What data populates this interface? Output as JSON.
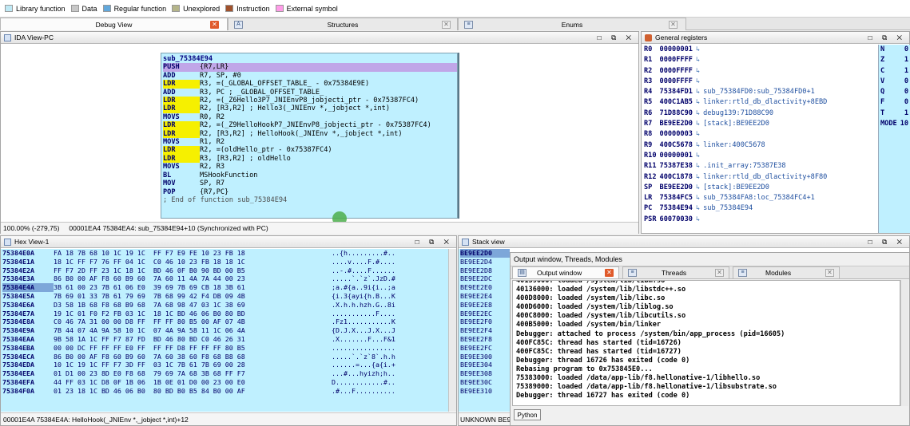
{
  "legend": [
    {
      "label": "Library function",
      "color": "#bfe9f5"
    },
    {
      "label": "Data",
      "color": "#c8c8c8"
    },
    {
      "label": "Regular function",
      "color": "#62a8dc"
    },
    {
      "label": "Unexplored",
      "color": "#b5b58a"
    },
    {
      "label": "Instruction",
      "color": "#a0522d"
    },
    {
      "label": "External symbol",
      "color": "#ff9ce8"
    }
  ],
  "tabs": {
    "debug_view": "Debug View",
    "structures": "Structures",
    "enums": "Enums"
  },
  "ida_view": {
    "title": "IDA View-PC",
    "func_label": "sub_75384E94",
    "lines": [
      {
        "op": "PUSH",
        "args": "{R7,LR}"
      },
      {
        "op": "ADD",
        "args": "R7, SP, #0"
      },
      {
        "op": "LDR",
        "args": "R3, =(_GLOBAL_OFFSET_TABLE_ - 0x75384E9E)"
      },
      {
        "op": "ADD",
        "args": "R3, PC ; _GLOBAL_OFFSET_TABLE_"
      },
      {
        "op": "LDR",
        "args": "R2, =(_Z6Hello3P7_JNIEnvP8_jobjecti_ptr - 0x75387FC4)"
      },
      {
        "op": "LDR",
        "args": "R2, [R3,R2] ; Hello3(_JNIEnv *,_jobject *,int)"
      },
      {
        "op": "MOVS",
        "args": "R0, R2"
      },
      {
        "op": "LDR",
        "args": "R2, =(_Z9HelloHookP7_JNIEnvP8_jobjecti_ptr - 0x75387FC4)"
      },
      {
        "op": "LDR",
        "args": "R2, [R3,R2] ; HelloHook(_JNIEnv *,_jobject *,int)"
      },
      {
        "op": "MOVS",
        "args": "R1, R2"
      },
      {
        "op": "LDR",
        "args": "R2, =(oldHello_ptr - 0x75387FC4)"
      },
      {
        "op": "LDR",
        "args": "R3, [R3,R2] ; oldHello"
      },
      {
        "op": "MOVS",
        "args": "R2, R3"
      },
      {
        "op": "BL",
        "args": "MSHookFunction"
      },
      {
        "op": "MOV",
        "args": "SP, R7"
      },
      {
        "op": "POP",
        "args": "{R7,PC}"
      }
    ],
    "end_comment": "; End of function sub_75384E94",
    "status_zoom": "100.00% (-279,75)",
    "status_loc": "00001EA4 75384EA4: sub_75384E94+10 (Synchronized with PC)"
  },
  "registers": {
    "title": "General registers",
    "rows": [
      {
        "name": "R0",
        "val": "00000001",
        "note": ""
      },
      {
        "name": "R1",
        "val": "0000FFFF",
        "note": ""
      },
      {
        "name": "R2",
        "val": "0000FFFF",
        "note": ""
      },
      {
        "name": "R3",
        "val": "0000FFFF",
        "note": ""
      },
      {
        "name": "R4",
        "val": "75384FD1",
        "note": "sub_75384FD0:sub_75384FD0+1"
      },
      {
        "name": "R5",
        "val": "400C1AB5",
        "note": "linker:rtld_db_dlactivity+8EBD"
      },
      {
        "name": "R6",
        "val": "71D88C90",
        "note": "debug139:71D88C90"
      },
      {
        "name": "R7",
        "val": "BE9EE2D0",
        "note": "[stack]:BE9EE2D0"
      },
      {
        "name": "R8",
        "val": "00000003",
        "note": ""
      },
      {
        "name": "R9",
        "val": "400C5678",
        "note": "linker:400C5678"
      },
      {
        "name": "R10",
        "val": "00000001",
        "note": ""
      },
      {
        "name": "R11",
        "val": "75387E38",
        "note": ".init_array:75387E38"
      },
      {
        "name": "R12",
        "val": "400C1878",
        "note": "linker:rtld_db_dlactivity+8F80"
      },
      {
        "name": "SP",
        "val": "BE9EE2D0",
        "note": "[stack]:BE9EE2D0"
      },
      {
        "name": "LR",
        "val": "75384FC5",
        "note": "sub_75384FA8:loc_75384FC4+1"
      },
      {
        "name": "PC",
        "val": "75384E94",
        "note": "sub_75384E94"
      },
      {
        "name": "PSR",
        "val": "60070030",
        "note": ""
      }
    ],
    "flags": [
      {
        "name": "N",
        "val": "0"
      },
      {
        "name": "Z",
        "val": "1"
      },
      {
        "name": "C",
        "val": "1"
      },
      {
        "name": "V",
        "val": "0"
      },
      {
        "name": "Q",
        "val": "0"
      },
      {
        "name": "F",
        "val": "0"
      },
      {
        "name": "T",
        "val": "1"
      },
      {
        "name": "MODE",
        "val": "10"
      }
    ]
  },
  "hex_view": {
    "title": "Hex View-1",
    "rows": [
      {
        "addr": "75384E0A",
        "bytes": "FA 18 7B 68 10 1C 19 1C  FF F7 E9 FE 10 23 FB 18",
        "ascii": "..{h.........#.."
      },
      {
        "addr": "75384E1A",
        "bytes": "18 1C FF F7 76 FF 04 1C  C0 46 10 23 FB 18 18 1C",
        "ascii": "....v....F.#...."
      },
      {
        "addr": "75384E2A",
        "bytes": "FF F7 2D FF 23 1C 18 1C  BD 46 0F B0 90 BD 00 B5",
        "ascii": "..-.#....F......"
      },
      {
        "addr": "75384E3A",
        "bytes": "86 B0 00 AF F8 60 B9 60  7A 60 11 4A 7A 44 00 23",
        "ascii": ".....`.`z`.JzD.#"
      },
      {
        "addr": "75384E4A",
        "bytes": "3B 61 00 23 7B 61 06 E0  39 69 7B 69 CB 18 3B 61",
        "ascii": ";a.#{a..9i{i..;a"
      },
      {
        "addr": "75384E5A",
        "bytes": "7B 69 01 33 7B 61 79 69  7B 68 99 42 F4 DB 09 4B",
        "ascii": "{i.3{ayi{h.B...K"
      },
      {
        "addr": "75384E6A",
        "bytes": "D3 58 1B 68 F8 68 B9 68  7A 68 98 47 03 1C 38 69",
        "ascii": ".X.h.h.hzh.G..8i"
      },
      {
        "addr": "75384E7A",
        "bytes": "19 1C 01 F0 F2 FB 03 1C  18 1C BD 46 06 B0 80 BD",
        "ascii": "...........F...."
      },
      {
        "addr": "75384E8A",
        "bytes": "C0 46 7A 31 00 00 D8 FF  FF FF 80 B5 00 AF 07 4B",
        "ascii": ".Fz1...........K"
      },
      {
        "addr": "75384E9A",
        "bytes": "7B 44 07 4A 9A 58 10 1C  07 4A 9A 58 11 1C 06 4A",
        "ascii": "{D.J.X...J.X...J"
      },
      {
        "addr": "75384EAA",
        "bytes": "9B 58 1A 1C FF F7 87 FD  BD 46 80 BD C0 46 26 31",
        "ascii": ".X.......F...F&1"
      },
      {
        "addr": "75384EBA",
        "bytes": "00 00 DC FF FF FF E0 FF  FF FF D8 FF FF FF 80 B5",
        "ascii": "................"
      },
      {
        "addr": "75384ECA",
        "bytes": "86 B0 00 AF F8 60 B9 60  7A 60 38 60 F8 68 B8 68",
        "ascii": ".....`.`z`8`.h.h"
      },
      {
        "addr": "75384EDA",
        "bytes": "10 1C 19 1C FF F7 3D FF  03 1C 7B 61 7B 69 00 28",
        "ascii": "......=...{a{i.+"
      },
      {
        "addr": "75384EEA",
        "bytes": "01 D1 00 23 8D E0 F8 68  79 69 7A 68 3B 68 FF F7",
        "ascii": "...#...hyizh;h.."
      },
      {
        "addr": "75384EFA",
        "bytes": "44 FF 03 1C D8 0F 1B 06  1B 0E 01 D0 00 23 00 E0",
        "ascii": "D............#.."
      },
      {
        "addr": "75384F0A",
        "bytes": "01 23 18 1C BD 46 06 B0  80 BD B0 B5 84 B0 00 AF",
        "ascii": ".#...F.........."
      }
    ],
    "status": "00001E4A 75384E4A: HelloHook(_JNIEnv *,_jobject *,int)+12"
  },
  "stack_view": {
    "title": "Stack view",
    "rows": [
      "BE9EE2D0",
      "BE9EE2D4",
      "BE9EE2D8",
      "BE9EE2DC",
      "BE9EE2E0",
      "BE9EE2E4",
      "BE9EE2E8",
      "BE9EE2EC",
      "BE9EE2F0",
      "BE9EE2F4",
      "BE9EE2F8",
      "BE9EE2FC",
      "BE9EE300",
      "BE9EE304",
      "BE9EE308",
      "BE9EE30C",
      "BE9EE310"
    ],
    "status": "UNKNOWN BE9EE"
  },
  "output": {
    "title": "Output window, Threads, Modules",
    "tab_output": "Output window",
    "tab_threads": "Threads",
    "tab_modules": "Modules",
    "lines": [
      "40139000: loaded /system/lib/libm.so",
      "40136000: loaded /system/lib/libstdc++.so",
      "400D8000: loaded /system/lib/libc.so",
      "400D6000: loaded /system/lib/liblog.so",
      "400C8000: loaded /system/lib/libcutils.so",
      "400B5000: loaded /system/bin/linker",
      "Debugger: attached to process /system/bin/app_process (pid=16605)",
      "400FC85C: thread has started (tid=16726)",
      "400FC85C: thread has started (tid=16727)",
      "Debugger: thread 16726 has exited (code 0)",
      "Rebasing program to 0x753845E0...",
      "75383000: loaded /data/app-lib/f8.hellonative-1/libhello.so",
      "75389000: loaded /data/app-lib/f8.hellonative-1/libsubstrate.so",
      "Debugger: thread 16727 has exited (code 0)"
    ],
    "python_button": "Python"
  }
}
